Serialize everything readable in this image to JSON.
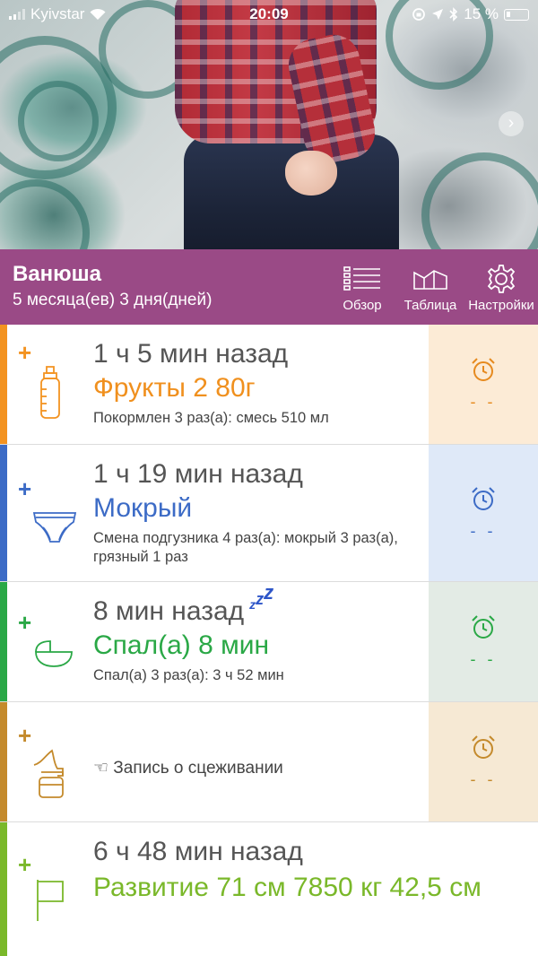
{
  "status_bar": {
    "carrier": "Kyivstar",
    "time": "20:09",
    "battery": "15 %"
  },
  "profile": {
    "name": "Ванюша",
    "age": "5 месяца(ев) 3 дня(дней)",
    "nav": [
      {
        "label": "Обзор",
        "icon": "list-icon"
      },
      {
        "label": "Таблица",
        "icon": "chart-area-icon"
      },
      {
        "label": "Настройки",
        "icon": "gear-icon"
      }
    ]
  },
  "cards": {
    "feeding": {
      "plus": "+",
      "time": "1 ч 5 мин назад",
      "title": "Фрукты 2 80г",
      "detail": "Покормлен 3 раз(а): смесь 510 мл",
      "icon": "bottle-icon",
      "alarm": "- -",
      "color": "#f39321"
    },
    "diaper": {
      "plus": "+",
      "time": "1 ч 19 мин назад",
      "title": "Мокрый",
      "detail": "Смена подгузника 4 раз(а): мокрый 3 раз(а), грязный 1 раз",
      "icon": "diaper-icon",
      "alarm": "- -",
      "color": "#3c6bc6"
    },
    "sleep": {
      "plus": "+",
      "time": "8 мин назад",
      "title": "Спал(а) 8 мин",
      "detail": "Спал(а) 3 раз(а): 3 ч 52 мин",
      "icon": "cradle-icon",
      "alarm": "- -",
      "color": "#2aa846"
    },
    "pump": {
      "plus": "+",
      "hint": "☜ Запись о сцеживании",
      "icon": "breast-pump-icon",
      "alarm": "- -",
      "color": "#c48a2c"
    },
    "growth": {
      "plus": "+",
      "time": "6 ч 48 мин назад",
      "title": "Развитие 71 см 7850 кг 42,5 см",
      "icon": "flag-icon",
      "color": "#7ab82a"
    }
  }
}
